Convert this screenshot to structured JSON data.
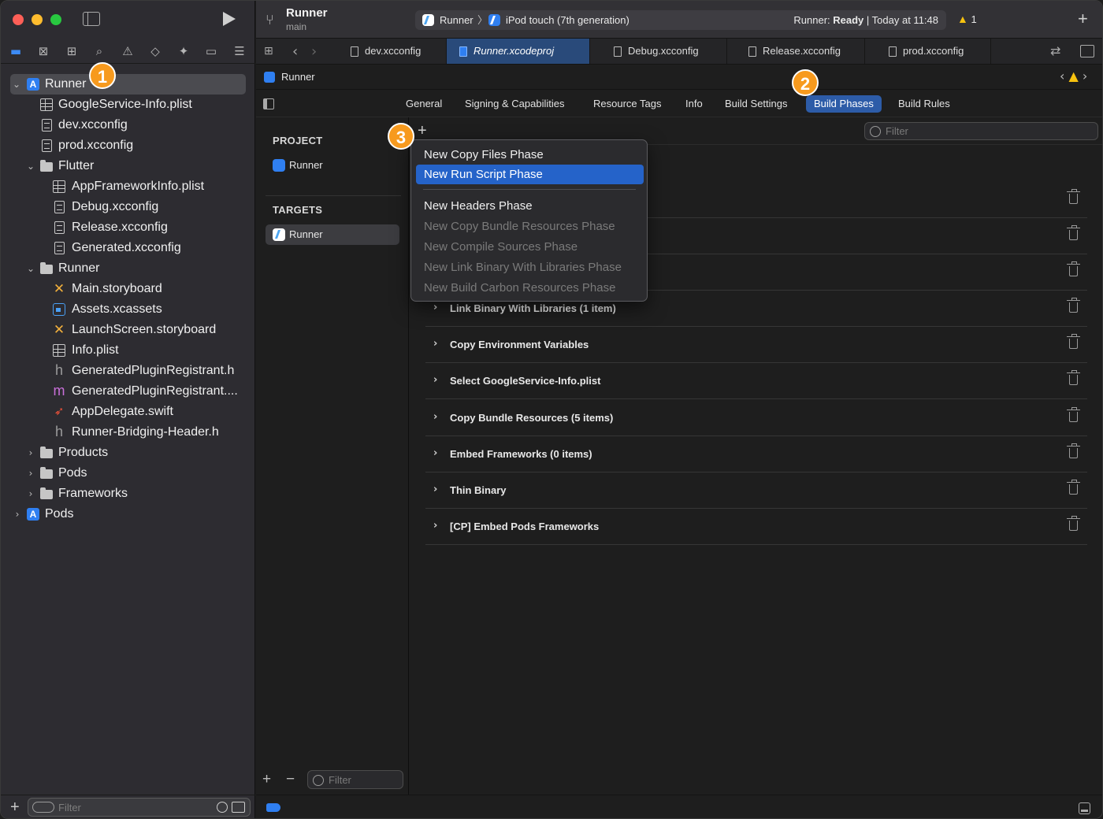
{
  "toolbar": {
    "project": "Runner",
    "branch": "main",
    "scheme_target": "Runner",
    "scheme_device": "iPod touch (7th generation)",
    "status_prefix": "Runner:",
    "status_state": "Ready",
    "status_time": "| Today at 11:48",
    "warning_count": "1"
  },
  "tabs": [
    {
      "label": "dev.xcconfig"
    },
    {
      "label": "Runner.xcodeproj"
    },
    {
      "label": "Debug.xcconfig"
    },
    {
      "label": "Release.xcconfig"
    },
    {
      "label": "prod.xcconfig"
    }
  ],
  "jumpbar": {
    "label": "Runner"
  },
  "editor_tabs": [
    {
      "label": "General"
    },
    {
      "label": "Signing & Capabilities"
    },
    {
      "label": "Resource Tags"
    },
    {
      "label": "Info"
    },
    {
      "label": "Build Settings"
    },
    {
      "label": "Build Phases"
    },
    {
      "label": "Build Rules"
    }
  ],
  "navigator": {
    "items": [
      {
        "label": "Runner",
        "chevron": "⌄"
      },
      {
        "label": "GoogleService-Info.plist"
      },
      {
        "label": "dev.xcconfig"
      },
      {
        "label": "prod.xcconfig"
      },
      {
        "label": "Flutter",
        "chevron": "⌄"
      },
      {
        "label": "AppFrameworkInfo.plist"
      },
      {
        "label": "Debug.xcconfig"
      },
      {
        "label": "Release.xcconfig"
      },
      {
        "label": "Generated.xcconfig"
      },
      {
        "label": "Runner",
        "chevron": "⌄"
      },
      {
        "label": "Main.storyboard"
      },
      {
        "label": "Assets.xcassets"
      },
      {
        "label": "LaunchScreen.storyboard"
      },
      {
        "label": "Info.plist"
      },
      {
        "label": "GeneratedPluginRegistrant.h"
      },
      {
        "label": "GeneratedPluginRegistrant...."
      },
      {
        "label": "AppDelegate.swift"
      },
      {
        "label": "Runner-Bridging-Header.h"
      },
      {
        "label": "Products",
        "chevron": "›"
      },
      {
        "label": "Pods",
        "chevron": "›"
      },
      {
        "label": "Frameworks",
        "chevron": "›"
      },
      {
        "label": "Pods",
        "chevron": "›"
      }
    ],
    "filter_placeholder": "Filter"
  },
  "targets_pane": {
    "project_header": "PROJECT",
    "project_item": "Runner",
    "targets_header": "TARGETS",
    "target_item": "Runner",
    "filter_placeholder": "Filter"
  },
  "phases": {
    "filter_placeholder": "Filter",
    "rows": [
      {
        "title": ""
      },
      {
        "title": ""
      },
      {
        "title": ""
      },
      {
        "title": "Link Binary With Libraries (1 item)"
      },
      {
        "title": "Copy Environment Variables"
      },
      {
        "title": "Select GoogleService-Info.plist"
      },
      {
        "title": "Copy Bundle Resources (5 items)"
      },
      {
        "title": "Embed Frameworks (0 items)"
      },
      {
        "title": "Thin Binary"
      },
      {
        "title": "[CP] Embed Pods Frameworks"
      }
    ]
  },
  "menu": {
    "items": [
      {
        "label": "New Copy Files Phase",
        "state": "enabled"
      },
      {
        "label": "New Run Script Phase",
        "state": "highlighted"
      },
      {
        "label": "New Headers Phase",
        "state": "enabled"
      },
      {
        "label": "New Copy Bundle Resources Phase",
        "state": "disabled"
      },
      {
        "label": "New Compile Sources Phase",
        "state": "disabled"
      },
      {
        "label": "New Link Binary With Libraries Phase",
        "state": "disabled"
      },
      {
        "label": "New Build Carbon Resources Phase",
        "state": "disabled"
      }
    ]
  },
  "badges": [
    "1",
    "2",
    "3"
  ],
  "colors": {
    "accent": "#2563c9",
    "badge": "#f79a1e",
    "warning": "#f7c20f"
  }
}
